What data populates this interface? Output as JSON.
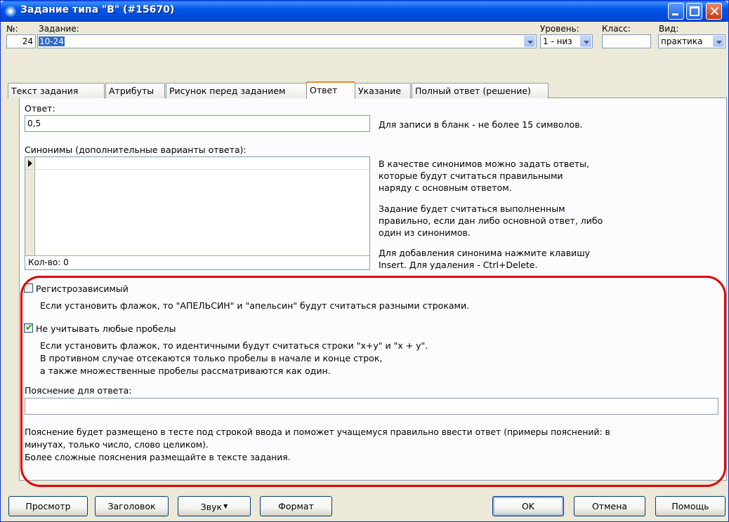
{
  "window": {
    "title": "Задание типа \"B\" (#15670)"
  },
  "header": {
    "number_label": "№:",
    "number_value": "24",
    "task_label": "Задание:",
    "task_value": "10-24",
    "level_label": "Уровень:",
    "level_value": "1 - низ",
    "class_label": "Класс:",
    "class_value": "",
    "view_label": "Вид:",
    "view_value": "практика"
  },
  "tabs": [
    {
      "label": "Текст задания"
    },
    {
      "label": "Атрибуты"
    },
    {
      "label": "Рисунок перед заданием"
    },
    {
      "label": "Ответ"
    },
    {
      "label": "Указание"
    },
    {
      "label": "Полный ответ (решение)"
    }
  ],
  "answer": {
    "label": "Ответ:",
    "value": "0,5",
    "hint": "Для записи в бланк - не более 15 символов."
  },
  "synonyms": {
    "label": "Синонимы (дополнительные варианты ответа):",
    "count_label": "Кол-во: 0",
    "help1": [
      "В качестве синонимов можно задать ответы,",
      "которые будут считаться правильными",
      "наряду с основным ответом."
    ],
    "help2": [
      "Задание будет считаться выполненным",
      "правильно, если дан либо основной ответ, либо",
      "один из синонимов."
    ],
    "help3": [
      "Для добавления синонима нажмите клавишу",
      "Insert. Для удаления - Ctrl+Delete."
    ]
  },
  "case_sensitive": {
    "label": "Регистрозависимый",
    "checked": false,
    "desc": "Если установить флажок, то \"АПЕЛЬСИН\" и \"апельсин\" будут считаться разными строками."
  },
  "ignore_spaces": {
    "label": "Не учитывать любые пробелы",
    "checked": true,
    "desc": [
      "Если установить флажок, то идентичными будут считаться строки \"x+y\" и \"x + y\".",
      "В противном случае отсекаются только пробелы в начале и конце строк,",
      "а также множественные пробелы рассматриваются как один."
    ]
  },
  "explanation": {
    "label": "Пояснение для ответа:",
    "value": "",
    "desc": [
      "Пояснение будет размещено в тесте под строкой ввода и поможет учащемуся правильно ввести ответ (примеры пояснений: в",
      "минутах, только число, слово целиком).",
      "Более сложные пояснения размещайте в тексте задания."
    ]
  },
  "buttons": {
    "preview": "Просмотр",
    "heading": "Заголовок",
    "sound": "Звук",
    "format": "Формат",
    "ok": "OK",
    "cancel": "Отмена",
    "help": "Помощь"
  },
  "colors": {
    "title_bar": "#0055e5",
    "dialog_face": "#ece9d8",
    "highlight": "#e00000",
    "selection": "#316ac5",
    "checkmark": "#21a121"
  },
  "icons": {
    "app": "app-icon",
    "minimize": "minimize-icon",
    "maximize": "maximize-icon",
    "close": "close-icon",
    "dropdown": "chevron-down-icon",
    "row_pointer": "row-pointer-icon",
    "checkmark": "checkmark-icon"
  }
}
